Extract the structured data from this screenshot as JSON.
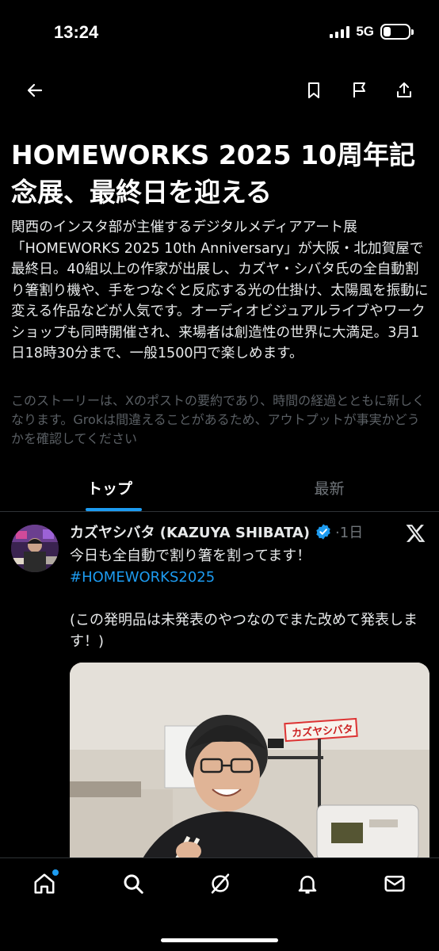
{
  "status_bar": {
    "time": "13:24",
    "network": "5G"
  },
  "top_nav": {
    "icons": [
      "back-arrow-icon",
      "bookmark-icon",
      "flag-icon",
      "share-icon"
    ]
  },
  "story": {
    "title": "HOMEWORKS 2025 10周年記念展、最終日を迎える",
    "summary": "関西のインスタ部が主催するデジタルメディアアート展「HOMEWORKS 2025 10th Anniversary」が大阪・北加賀屋で最終日。40組以上の作家が出展し、カズヤ・シバタ氏の全自動割り箸割り機や、手をつなぐと反応する光の仕掛け、太陽風を振動に変える作品などが人気です。オーディオビジュアルライブやワークショップも同時開催され、来場者は創造性の世界に大満足。3月1日18時30分まで、一般1500円で楽しめます。",
    "disclaimer": "このストーリーは、Xのポストの要約であり、時間の経過とともに新しくなります。Grokは間違えることがあるため、アウトプットが事実かどうかを確認してください"
  },
  "tabs": [
    {
      "label": "トップ",
      "active": true
    },
    {
      "label": "最新",
      "active": false
    }
  ],
  "post": {
    "author": "カズヤシバタ (KAZUYA SHIBATA)",
    "time": "·1日",
    "line1": "今日も全自動で割り箸を割ってます！",
    "hashtag": "#HOMEWORKS2025",
    "line2": "(この発明品は未発表のやつなのでまた改めて発表します！)",
    "image_sign_text": "カズヤシバタ"
  },
  "bottom_nav": {
    "icons": [
      "home-icon",
      "search-icon",
      "grok-icon",
      "notifications-icon",
      "messages-icon"
    ]
  },
  "colors": {
    "accent": "#1d9bf0",
    "background": "#000000",
    "text": "#e7e9ea",
    "muted": "#71767b"
  }
}
